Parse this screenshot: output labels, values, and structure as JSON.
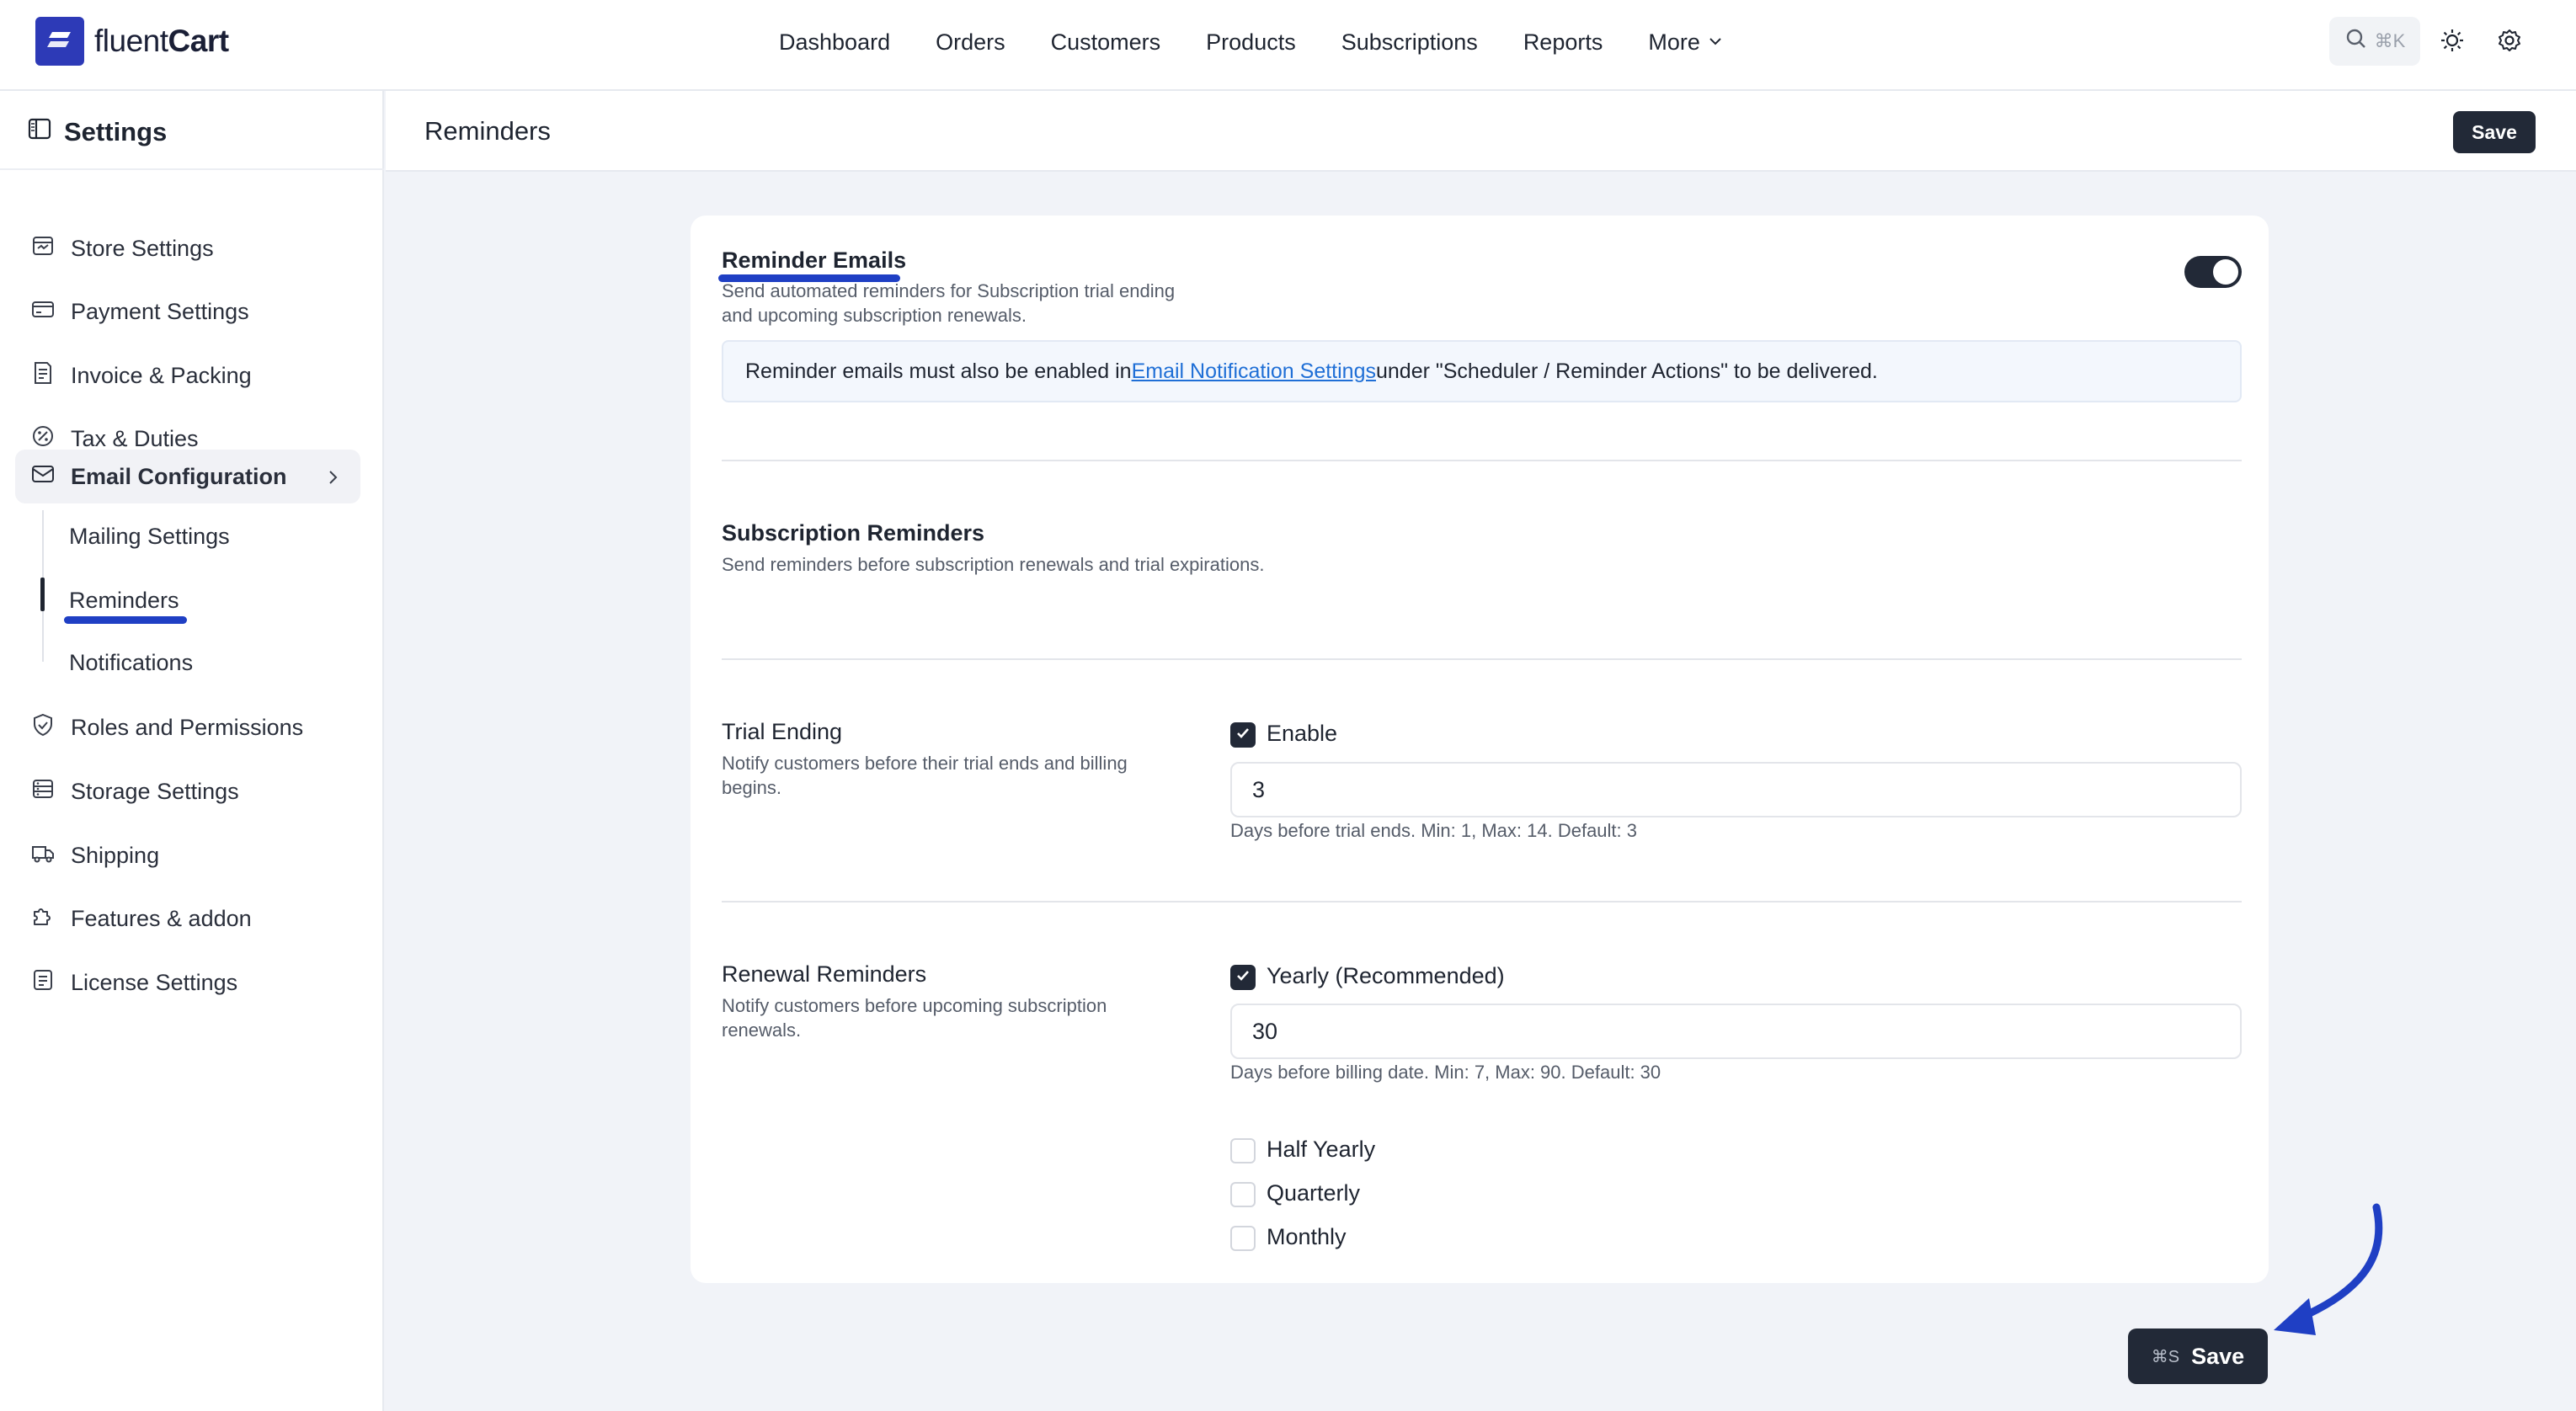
{
  "app": {
    "logo_text_light": "fluent",
    "logo_text_bold": "Cart"
  },
  "nav": {
    "items": [
      "Dashboard",
      "Orders",
      "Customers",
      "Products",
      "Subscriptions",
      "Reports",
      "More"
    ],
    "search_shortcut": "⌘K"
  },
  "sidebar": {
    "title": "Settings",
    "items": [
      {
        "label": "Store Settings",
        "icon": "store-icon"
      },
      {
        "label": "Payment Settings",
        "icon": "card-icon"
      },
      {
        "label": "Invoice & Packing",
        "icon": "invoice-icon"
      },
      {
        "label": "Tax & Duties",
        "icon": "percent-icon"
      },
      {
        "label": "Email Configuration",
        "icon": "mail-icon"
      },
      {
        "label": "Roles and Permissions",
        "icon": "shield-icon"
      },
      {
        "label": "Storage Settings",
        "icon": "storage-icon"
      },
      {
        "label": "Shipping",
        "icon": "truck-icon"
      },
      {
        "label": "Features & addon",
        "icon": "puzzle-icon"
      },
      {
        "label": "License Settings",
        "icon": "license-icon"
      }
    ],
    "sub_items": [
      "Mailing Settings",
      "Reminders",
      "Notifications"
    ],
    "active_sub": "Reminders"
  },
  "header": {
    "title": "Reminders",
    "save_label": "Save"
  },
  "reminder_emails": {
    "title": "Reminder Emails",
    "desc_line1": "Send automated reminders for Subscription trial ending",
    "desc_line2": "and upcoming subscription renewals.",
    "enabled": true,
    "notice_prefix": "Reminder emails must also be enabled in ",
    "notice_link": "Email Notification Settings",
    "notice_suffix": " under \"Scheduler / Reminder Actions\" to be delivered."
  },
  "subscription_reminders": {
    "title": "Subscription Reminders",
    "desc": "Send reminders before subscription renewals and trial expirations."
  },
  "trial_ending": {
    "title": "Trial Ending",
    "desc_line1": "Notify customers before their trial ends and billing",
    "desc_line2": "begins.",
    "enable_label": "Enable",
    "enabled": true,
    "value": "3",
    "hint": "Days before trial ends. Min: 1, Max: 14. Default: 3"
  },
  "renewal_reminders": {
    "title": "Renewal Reminders",
    "desc_line1": "Notify customers before upcoming subscription",
    "desc_line2": "renewals.",
    "yearly_label": "Yearly (Recommended)",
    "yearly_checked": true,
    "yearly_value": "30",
    "yearly_hint": "Days before billing date. Min: 7, Max: 90. Default: 30",
    "options": [
      {
        "label": "Half Yearly",
        "checked": false
      },
      {
        "label": "Quarterly",
        "checked": false
      },
      {
        "label": "Monthly",
        "checked": false
      }
    ]
  },
  "footer": {
    "save_shortcut": "⌘S",
    "save_label": "Save"
  },
  "colors": {
    "brand": "#2d3ab7",
    "dark_button": "#222937",
    "annotation": "#1f3fc4",
    "link": "#1f6fd6"
  }
}
